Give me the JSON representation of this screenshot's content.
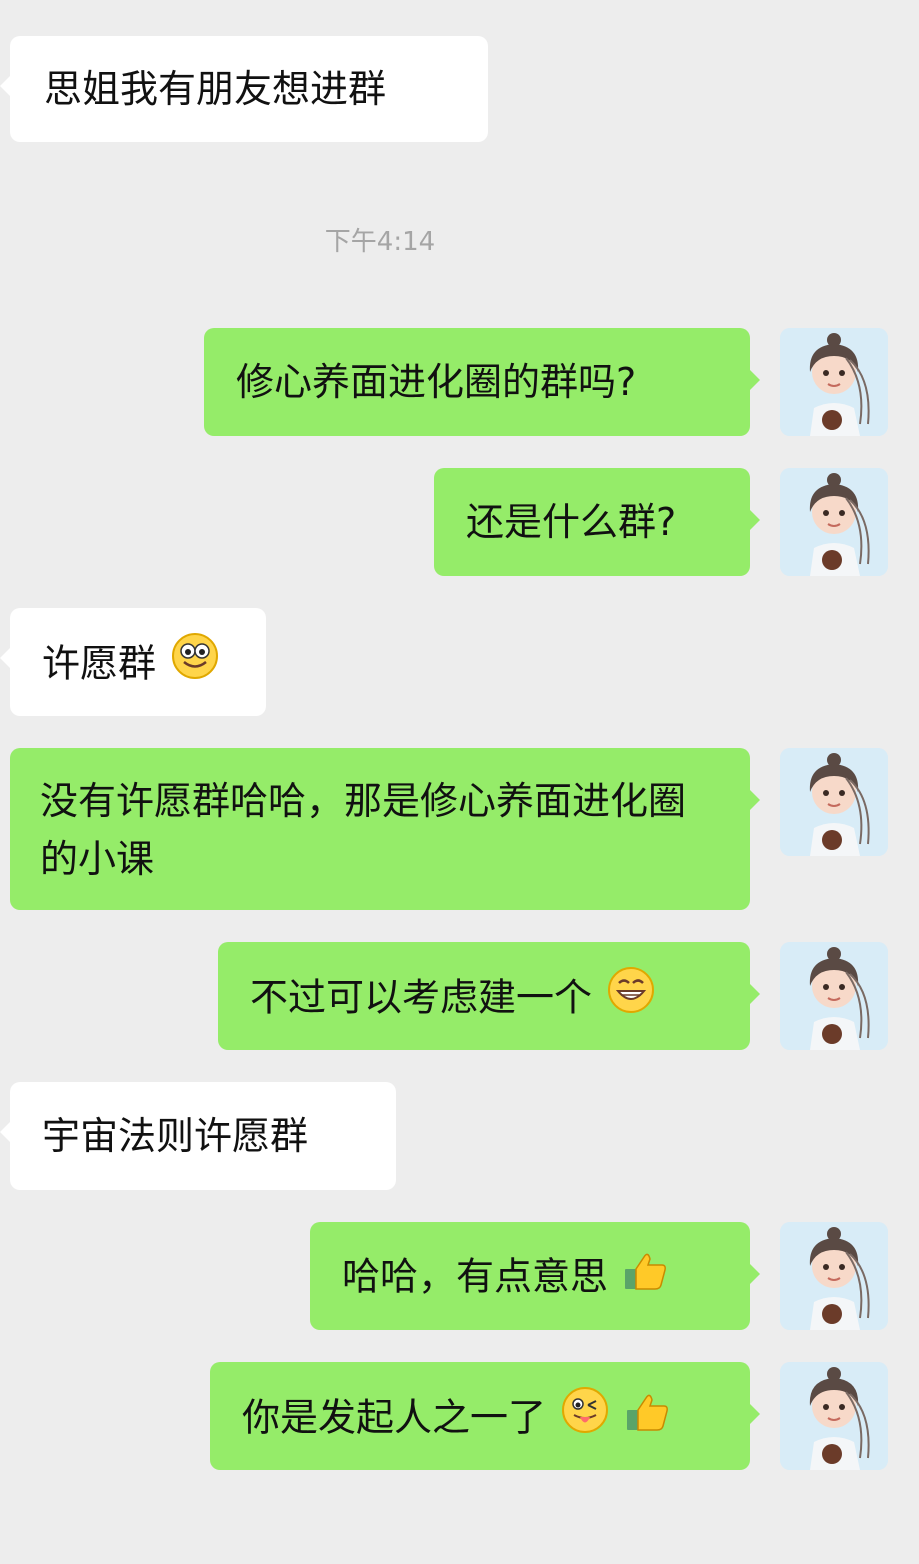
{
  "conversation": {
    "timestamp": "下午4:14",
    "messages": [
      {
        "side": "left",
        "text": "思姐我有朋友想进群"
      },
      {
        "side": "right",
        "text": "修心养面进化圈的群吗?"
      },
      {
        "side": "right",
        "text": "还是什么群?"
      },
      {
        "side": "left",
        "text": "许愿群"
      },
      {
        "side": "right",
        "text": "没有许愿群哈哈，那是修心养面进化圈的小课"
      },
      {
        "side": "right",
        "text": "不过可以考虑建一个"
      },
      {
        "side": "left",
        "text": "宇宙法则许愿群"
      },
      {
        "side": "right",
        "text": "哈哈，有点意思"
      },
      {
        "side": "right",
        "text": "你是发起人之一了"
      }
    ]
  },
  "colors": {
    "background": "#ededed",
    "incoming_bubble": "#ffffff",
    "outgoing_bubble": "#95ec69",
    "timestamp_text": "#a5a5a5"
  },
  "icons": {
    "avatar": "cartoon-woman-avatar",
    "emoji_1": "smile-emoji",
    "emoji_2": "grin-emoji",
    "emoji_3": "thumbs-up-emoji",
    "emoji_4": "wink-tongue-emoji",
    "emoji_5": "thumbs-up-emoji"
  }
}
